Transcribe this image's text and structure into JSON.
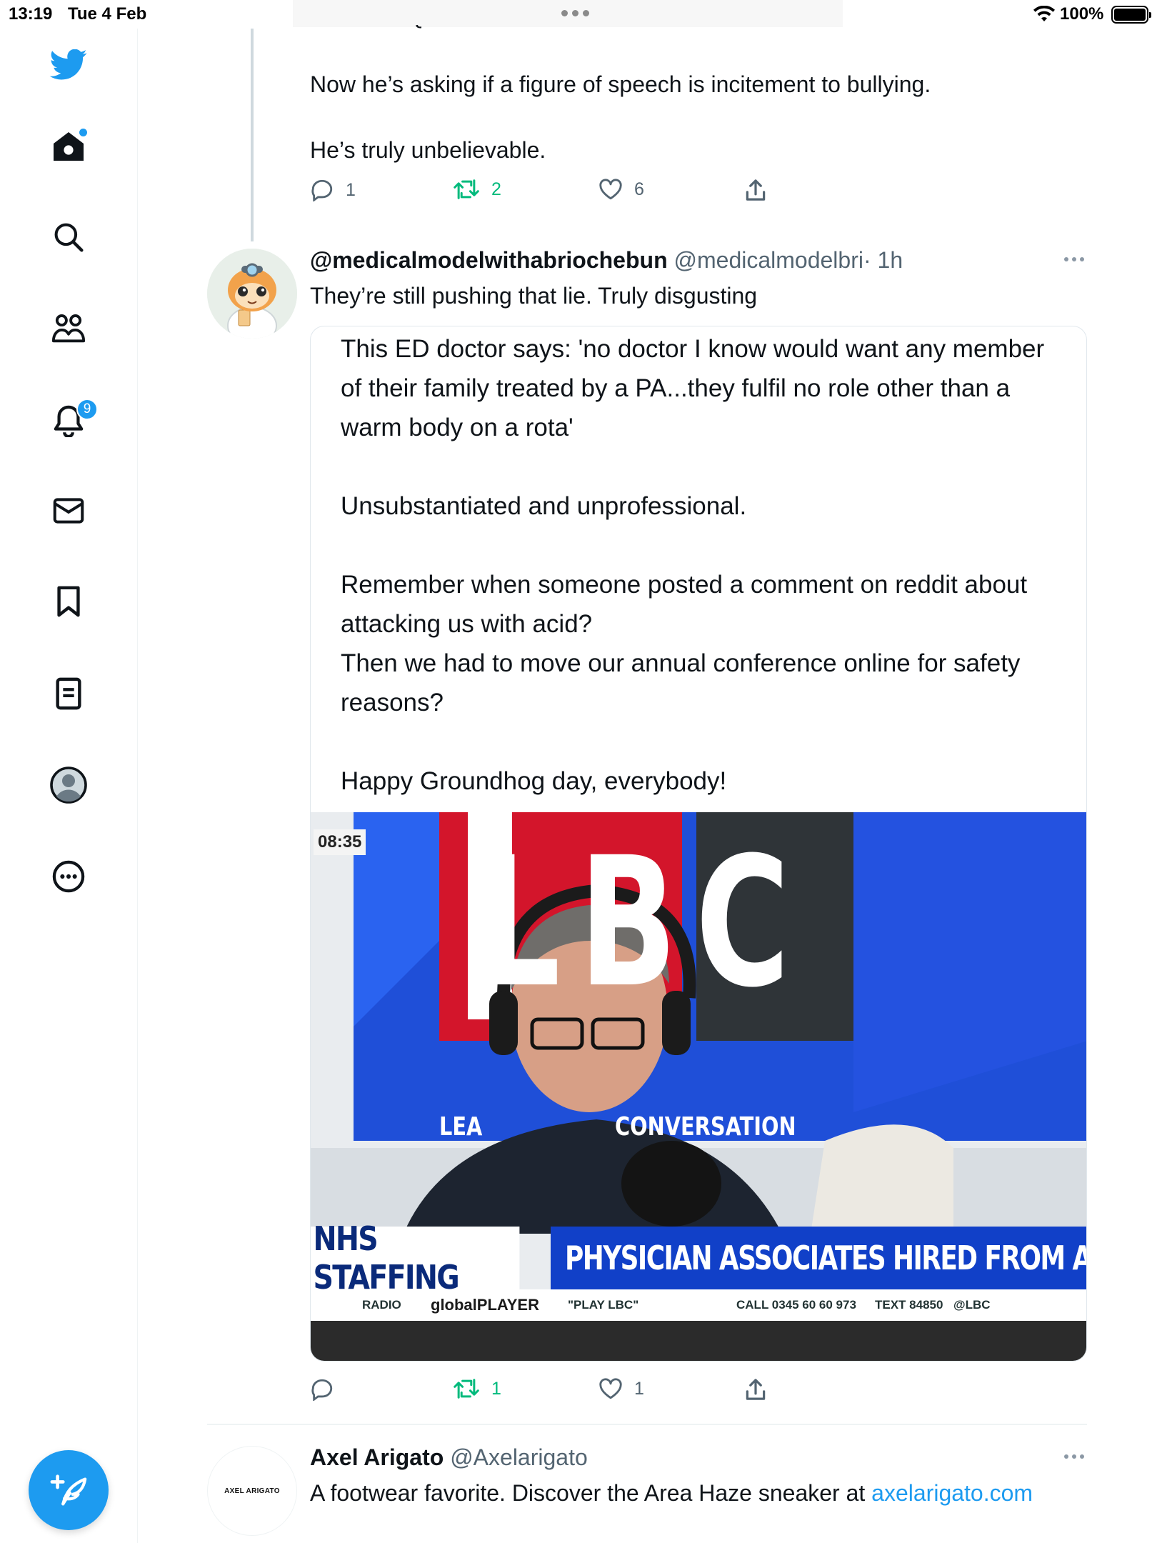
{
  "status_bar": {
    "time": "13:19",
    "date": "Tue 4 Feb",
    "battery": "100%"
  },
  "sidebar": {
    "notifications_badge": "9",
    "items": [
      "logo",
      "home",
      "explore",
      "communities",
      "notifications",
      "messages",
      "bookmarks",
      "lists",
      "profile",
      "more"
    ]
  },
  "prev_tweet": {
    "lines": [
      "Now he’s asking if a figure of speech is incitement to bullying.",
      "He’s truly unbelievable."
    ],
    "replies": "1",
    "retweets": "2",
    "likes": "6"
  },
  "tweet": {
    "display_name": "@medicalmodelwithabriochebun",
    "handle": "@medicalmodelbri",
    "time": "· 1h",
    "text": "They’re still pushing that lie. Truly disgusting",
    "quote_text": "This ED doctor says: 'no doctor I know would want any member of their family treated by a PA...they fulfil no role other than a warm body on a rota'\n\nUnsubstantiated and unprofessional.\n\nRemember when someone posted a comment on reddit about attacking us with acid?\nThen we had to move our annual conference online for safety reasons?\n\nHappy Groundhog day, everybody!",
    "media": {
      "timestamp": "08:35",
      "logo": "LBC",
      "slogan_left": "LEA",
      "slogan_right": "CONVERSATION",
      "strap_left": "NHS STAFFING",
      "strap_right": "PHYSICIAN ASSOCIATES HIRED FROM AB",
      "ticker": [
        "RADIO",
        "globalPLAYER",
        "\"PLAY LBC\"",
        "CALL 0345 60 60 973",
        "TEXT 84850",
        "@LBC"
      ]
    },
    "replies": "",
    "retweets": "1",
    "likes": "1"
  },
  "ad_tweet": {
    "display_name": "Axel Arigato",
    "handle": "@Axelarigato",
    "avatar_text": "AXEL ARIGATO",
    "text": "A footwear favorite. Discover the Area Haze sneaker at ",
    "link": "axelarigato.com"
  },
  "colors": {
    "accent": "#1d9bf0",
    "retweet": "#00ba7c",
    "muted": "#536471"
  }
}
